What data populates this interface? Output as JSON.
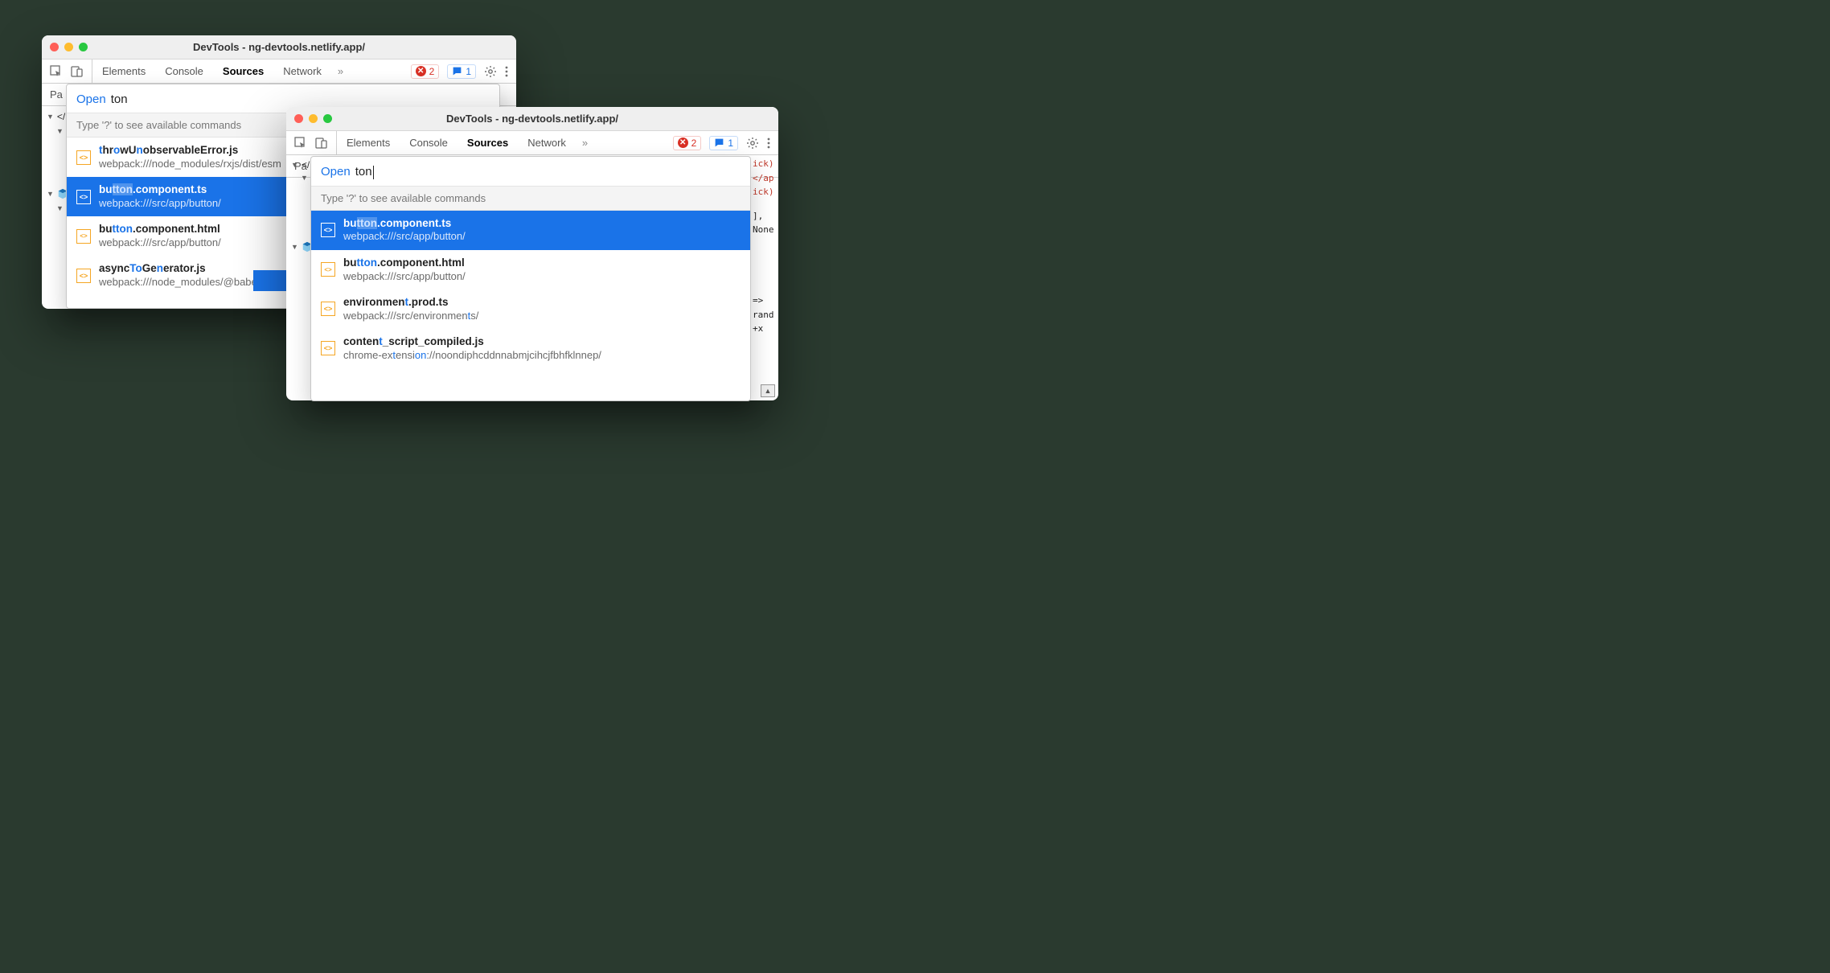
{
  "windowA": {
    "title": "DevTools - ng-devtools.netlify.app/",
    "tabs": {
      "elements": "Elements",
      "console": "Console",
      "sources": "Sources",
      "network": "Network"
    },
    "errors": "2",
    "messages": "1",
    "subpanel": "Pa",
    "tree": {
      "tag_open": "</",
      "dots": "…"
    },
    "popup": {
      "label": "Open",
      "query": "ton",
      "hint": "Type '?' to see available commands",
      "results": [
        {
          "name_pre": "",
          "name_hl1": "t",
          "name_mid1": "hr",
          "name_hl2": "o",
          "name_mid2": "wU",
          "name_hl3": "n",
          "name_post": "observableError.js",
          "path": "webpack:///node_modules/rxjs/dist/esm",
          "sel": false
        },
        {
          "name_pre": "bu",
          "name_hl1": "t",
          "name_mid1": "",
          "name_hl2": "to",
          "name_mid2": "",
          "name_hl3": "n",
          "name_post": ".component.ts",
          "path": "webpack:///src/app/button/",
          "sel": true
        },
        {
          "name_pre": "bu",
          "name_hl1": "t",
          "name_mid1": "",
          "name_hl2": "to",
          "name_mid2": "",
          "name_hl3": "n",
          "name_post": ".component.html",
          "path": "webpack:///src/app/button/",
          "sel": false
        },
        {
          "name_pre": "async",
          "name_hl1": "T",
          "name_mid1": "",
          "name_hl2": "o",
          "name_mid2": "Ge",
          "name_hl3": "n",
          "name_post": "erator.js",
          "path": "webpack:///node_modules/@babel/",
          "sel": false
        }
      ]
    }
  },
  "windowB": {
    "title": "DevTools - ng-devtools.netlify.app/",
    "tabs": {
      "elements": "Elements",
      "console": "Console",
      "sources": "Sources",
      "network": "Network"
    },
    "errors": "2",
    "messages": "1",
    "subpanel": "Pa",
    "tree": {
      "tag_open": "</",
      "dots": "…"
    },
    "popup": {
      "label": "Open",
      "query": "ton",
      "hint": "Type '?' to see available commands",
      "results": [
        {
          "name_pre": "bu",
          "name_hl1": "tton",
          "name_post": ".component.ts",
          "path": "webpack:///src/app/button/",
          "sel": true
        },
        {
          "name_pre": "bu",
          "name_hl1": "tton",
          "name_post": ".component.html",
          "path": "webpack:///src/app/button/",
          "sel": false
        },
        {
          "name_pre": "environmen",
          "name_hl1": "t",
          "name_post": ".prod.ts",
          "path_pre": "webpack:///src/environmen",
          "path_hl": "t",
          "path_post": "s/",
          "sel": false
        },
        {
          "name_pre": "conten",
          "name_hl1": "t",
          "name_post": "_script_compiled.js",
          "path_pre": "chrome-ex",
          "path_hl": "t",
          "path_mid": "ensi",
          "path_hl2": "on",
          "path_post": "://noondiphcddnnabmjcihcjfbhfklnnep/",
          "sel": false
        }
      ]
    },
    "code": {
      "l1": "ick)",
      "l2": "</ap",
      "l3": "ick)",
      "l4": "],",
      "l5": "None",
      "l6": "=>",
      "l7": "rand",
      "l8": "+x "
    }
  }
}
